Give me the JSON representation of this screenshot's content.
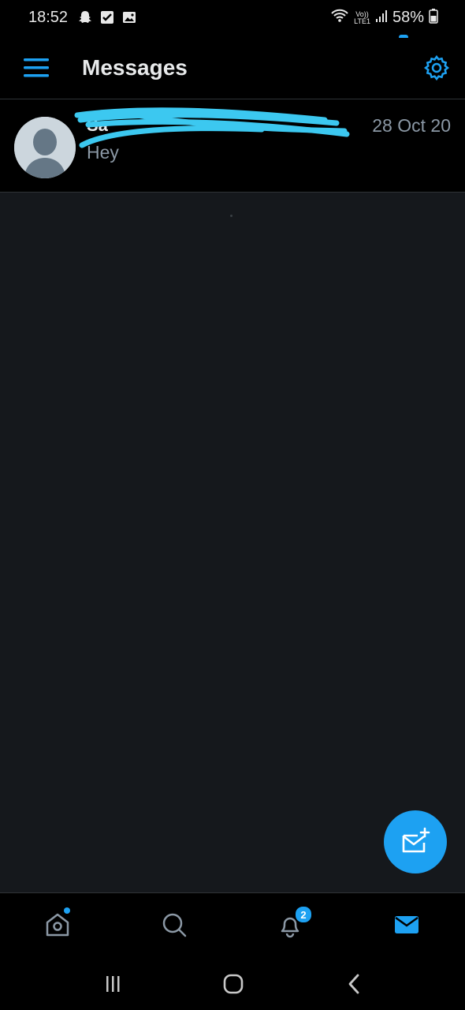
{
  "status_bar": {
    "time": "18:52",
    "battery": "58%",
    "network_top": "Vo))",
    "network_bottom": "LTE1",
    "left_icons": [
      "snapchat-icon",
      "checkbox-icon",
      "image-icon"
    ],
    "right_icons": [
      "wifi-icon",
      "signal-icon",
      "battery-icon"
    ]
  },
  "header": {
    "title": "Messages",
    "menu_icon": "hamburger-menu-icon",
    "settings_icon": "gear-icon"
  },
  "conversations": [
    {
      "name": "Sa",
      "date": "28 Oct 20",
      "preview": "Hey"
    }
  ],
  "bottom_nav": {
    "items": [
      {
        "name": "home",
        "icon": "home-icon",
        "has_dot": true
      },
      {
        "name": "search",
        "icon": "search-icon"
      },
      {
        "name": "notifications",
        "icon": "bell-icon",
        "badge": "2"
      },
      {
        "name": "messages",
        "icon": "mail-icon",
        "active": true
      }
    ]
  },
  "fab": {
    "icon": "new-message-icon"
  },
  "system_nav": [
    "recents-icon",
    "home-button-icon",
    "back-icon"
  ],
  "colors": {
    "accent": "#1da1f2",
    "background": "#000000",
    "content_bg": "#15181c",
    "muted_text": "#8b98a5",
    "scribble": "#3cc8f0"
  }
}
